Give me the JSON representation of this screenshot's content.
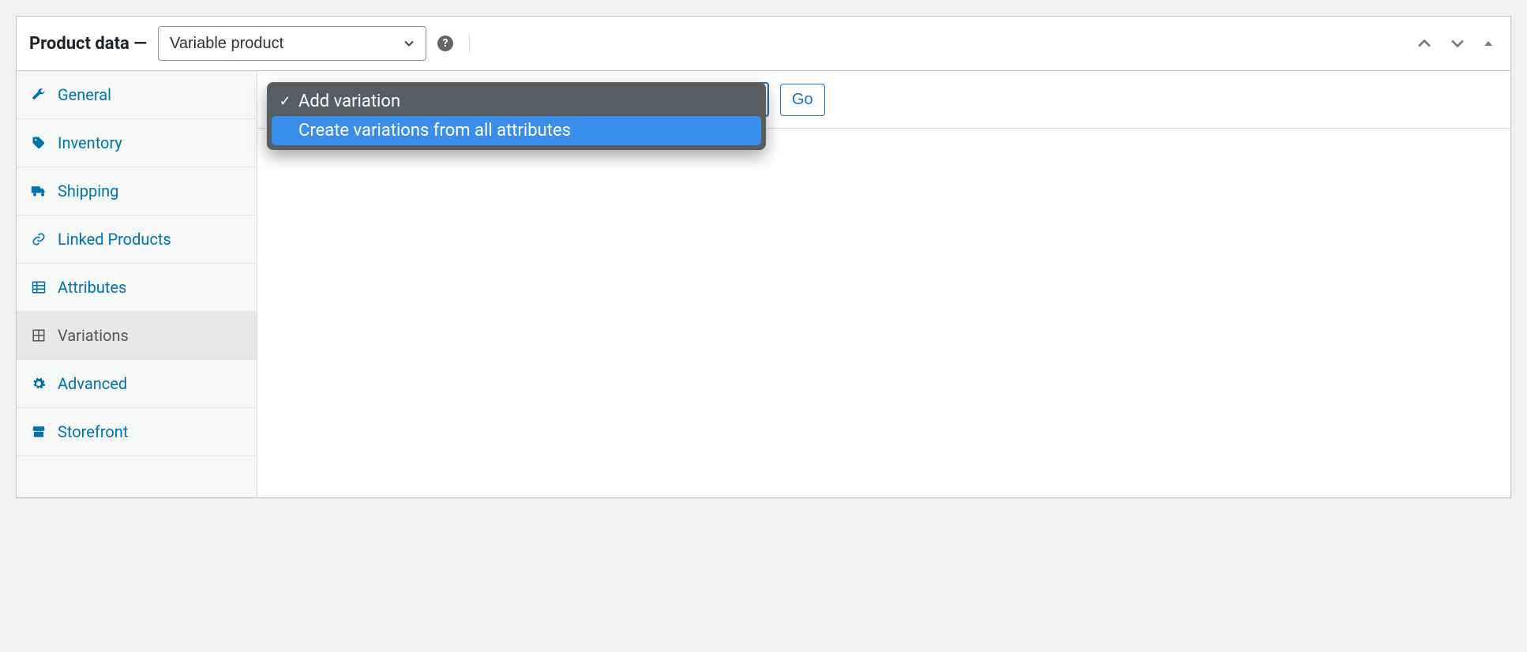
{
  "header": {
    "title": "Product data —",
    "product_type": "Variable product"
  },
  "tabs": [
    {
      "label": "General",
      "icon": "wrench-icon",
      "active": false
    },
    {
      "label": "Inventory",
      "icon": "tag-icon",
      "active": false
    },
    {
      "label": "Shipping",
      "icon": "truck-icon",
      "active": false
    },
    {
      "label": "Linked Products",
      "icon": "link-icon",
      "active": false
    },
    {
      "label": "Attributes",
      "icon": "list-icon",
      "active": false
    },
    {
      "label": "Variations",
      "icon": "grid-icon",
      "active": true
    },
    {
      "label": "Advanced",
      "icon": "gear-icon",
      "active": false
    },
    {
      "label": "Storefront",
      "icon": "store-icon",
      "active": false
    }
  ],
  "toolbar": {
    "go_label": "Go"
  },
  "dropdown": {
    "items": [
      {
        "label": "Add variation",
        "checked": true,
        "highlight": false
      },
      {
        "label": "Create variations from all attributes",
        "checked": false,
        "highlight": true
      }
    ]
  }
}
